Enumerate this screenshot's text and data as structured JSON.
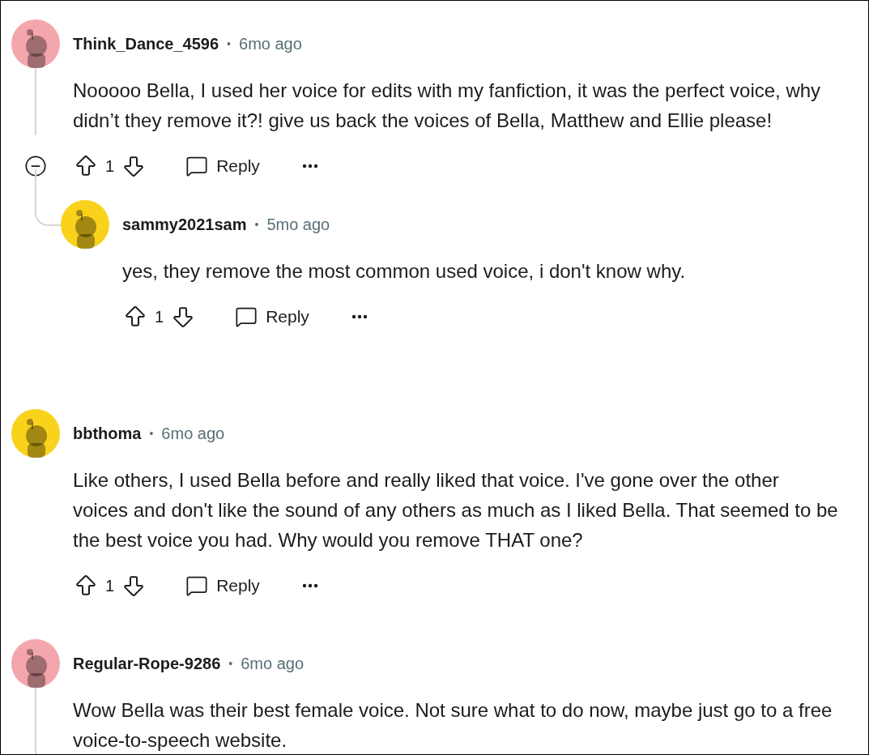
{
  "comments": [
    {
      "author": "Think_Dance_4596",
      "separator": "•",
      "time": "6mo ago",
      "color": "#f4a6ad",
      "thread": true,
      "collapse": true,
      "body": "Nooooo Bella, I used her voice for edits with my fanfiction, it was the perfect voice, why didn’t they remove it?! give us back the voices of Bella, Matthew and Ellie please!",
      "votes": "1",
      "reply_label": "Reply",
      "children": [
        {
          "author": "sammy2021sam",
          "separator": "•",
          "time": "5mo ago",
          "color": "#f9d21c",
          "thread": false,
          "collapse": false,
          "body": "yes, they remove the most common used voice, i don't know why.",
          "votes": "1",
          "reply_label": "Reply"
        }
      ]
    },
    {
      "author": "bbthoma",
      "separator": "•",
      "time": "6mo ago",
      "color": "#f9d21c",
      "thread": false,
      "collapse": false,
      "body": "Like others, I used Bella before and really liked that voice. I've gone over the other voices and don't like the sound of any others as much as I liked Bella. That seemed to be the best voice you had. Why would you remove THAT one?",
      "votes": "1",
      "reply_label": "Reply"
    },
    {
      "author": "Regular-Rope-9286",
      "separator": "•",
      "time": "6mo ago",
      "color": "#f4a6ad",
      "thread": true,
      "collapse": false,
      "body": "Wow Bella was their best female voice. Not sure what to do now, maybe just go to a free voice-to-speech website."
    }
  ]
}
